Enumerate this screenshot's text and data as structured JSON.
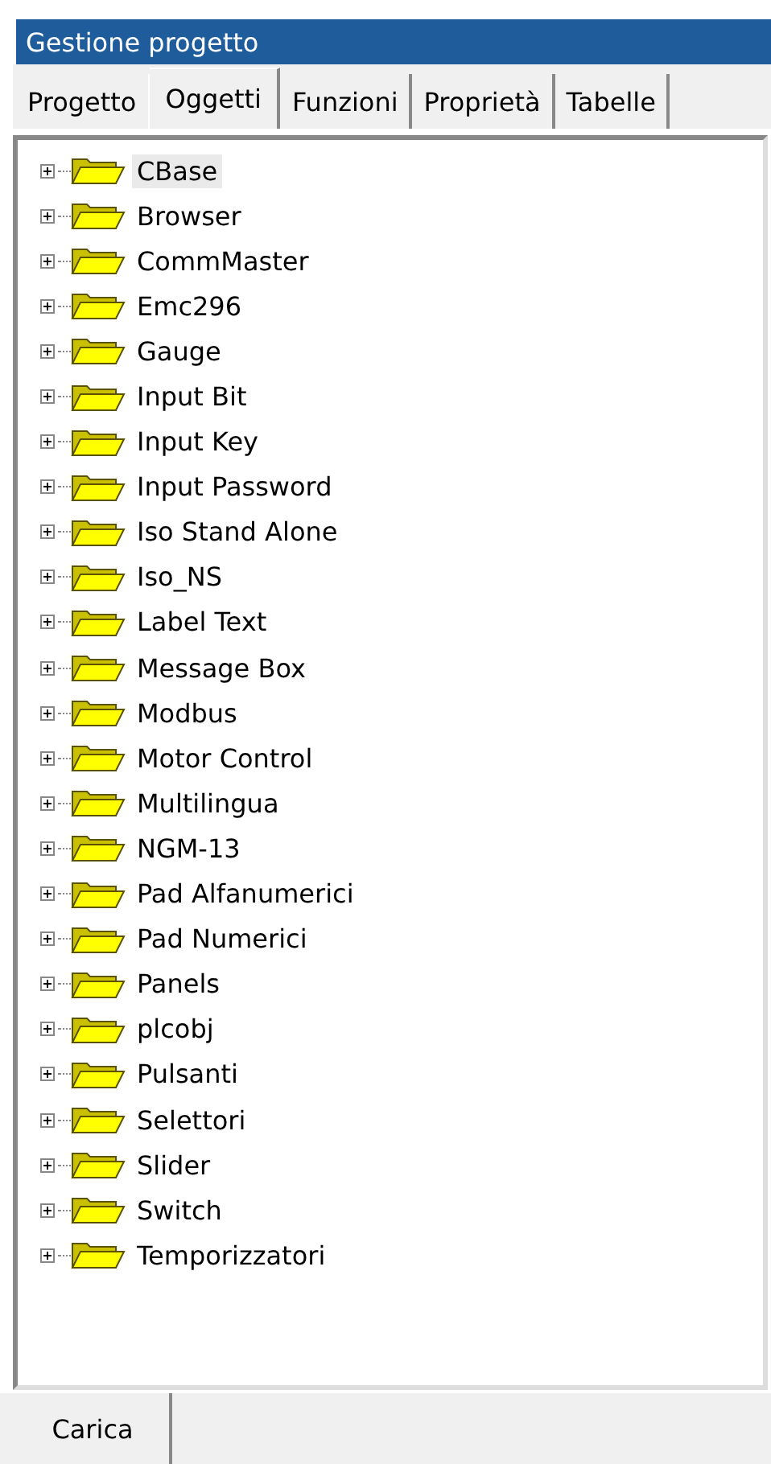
{
  "window": {
    "title": "Gestione progetto"
  },
  "tabs": [
    {
      "label": "Progetto",
      "selected": false
    },
    {
      "label": "Oggetti",
      "selected": true
    },
    {
      "label": "Funzioni",
      "selected": false
    },
    {
      "label": "Proprietà",
      "selected": false
    },
    {
      "label": "Tabelle",
      "selected": false
    }
  ],
  "tree": {
    "items": [
      {
        "label": "CBase",
        "selected": true,
        "expanded": false
      },
      {
        "label": "Browser",
        "selected": false,
        "expanded": false
      },
      {
        "label": "CommMaster",
        "selected": false,
        "expanded": false
      },
      {
        "label": "Emc296",
        "selected": false,
        "expanded": false
      },
      {
        "label": "Gauge",
        "selected": false,
        "expanded": false
      },
      {
        "label": "Input Bit",
        "selected": false,
        "expanded": false
      },
      {
        "label": "Input Key",
        "selected": false,
        "expanded": false
      },
      {
        "label": "Input Password",
        "selected": false,
        "expanded": false
      },
      {
        "label": "Iso Stand Alone",
        "selected": false,
        "expanded": false
      },
      {
        "label": "Iso_NS",
        "selected": false,
        "expanded": false
      },
      {
        "label": "Label Text",
        "selected": false,
        "expanded": false
      },
      {
        "label": "Message Box",
        "selected": false,
        "expanded": false
      },
      {
        "label": "Modbus",
        "selected": false,
        "expanded": false
      },
      {
        "label": "Motor Control",
        "selected": false,
        "expanded": false
      },
      {
        "label": "Multilingua",
        "selected": false,
        "expanded": false
      },
      {
        "label": "NGM-13",
        "selected": false,
        "expanded": false
      },
      {
        "label": "Pad Alfanumerici",
        "selected": false,
        "expanded": false
      },
      {
        "label": "Pad Numerici",
        "selected": false,
        "expanded": false
      },
      {
        "label": "Panels",
        "selected": false,
        "expanded": false
      },
      {
        "label": "plcobj",
        "selected": false,
        "expanded": false
      },
      {
        "label": "Pulsanti",
        "selected": false,
        "expanded": false
      },
      {
        "label": "Selettori",
        "selected": false,
        "expanded": false
      },
      {
        "label": "Slider",
        "selected": false,
        "expanded": false
      },
      {
        "label": "Switch",
        "selected": false,
        "expanded": false
      },
      {
        "label": "Temporizzatori",
        "selected": false,
        "expanded": false
      }
    ]
  },
  "bottom_tabs": [
    {
      "label": "Carica",
      "selected": true
    }
  ]
}
